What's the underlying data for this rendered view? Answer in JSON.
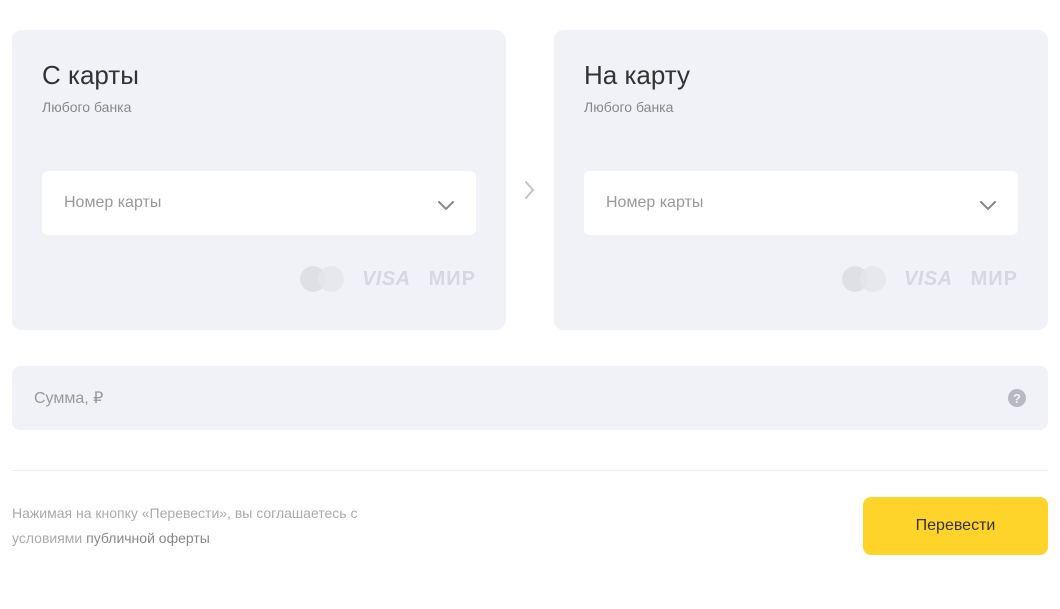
{
  "from_card": {
    "title": "С карты",
    "subtitle": "Любого банка",
    "number_placeholder": "Номер карты"
  },
  "to_card": {
    "title": "На карту",
    "subtitle": "Любого банка",
    "number_placeholder": "Номер карты"
  },
  "amount": {
    "placeholder": "Сумма, ₽"
  },
  "disclaimer": {
    "text_prefix": "Нажимая на кнопку «Перевести», вы соглашаетесь с условиями ",
    "link_text": "публичной оферты"
  },
  "transfer_button": "Перевести",
  "payment_labels": {
    "visa": "VISA",
    "mir": "МИР"
  },
  "help_label": "?"
}
